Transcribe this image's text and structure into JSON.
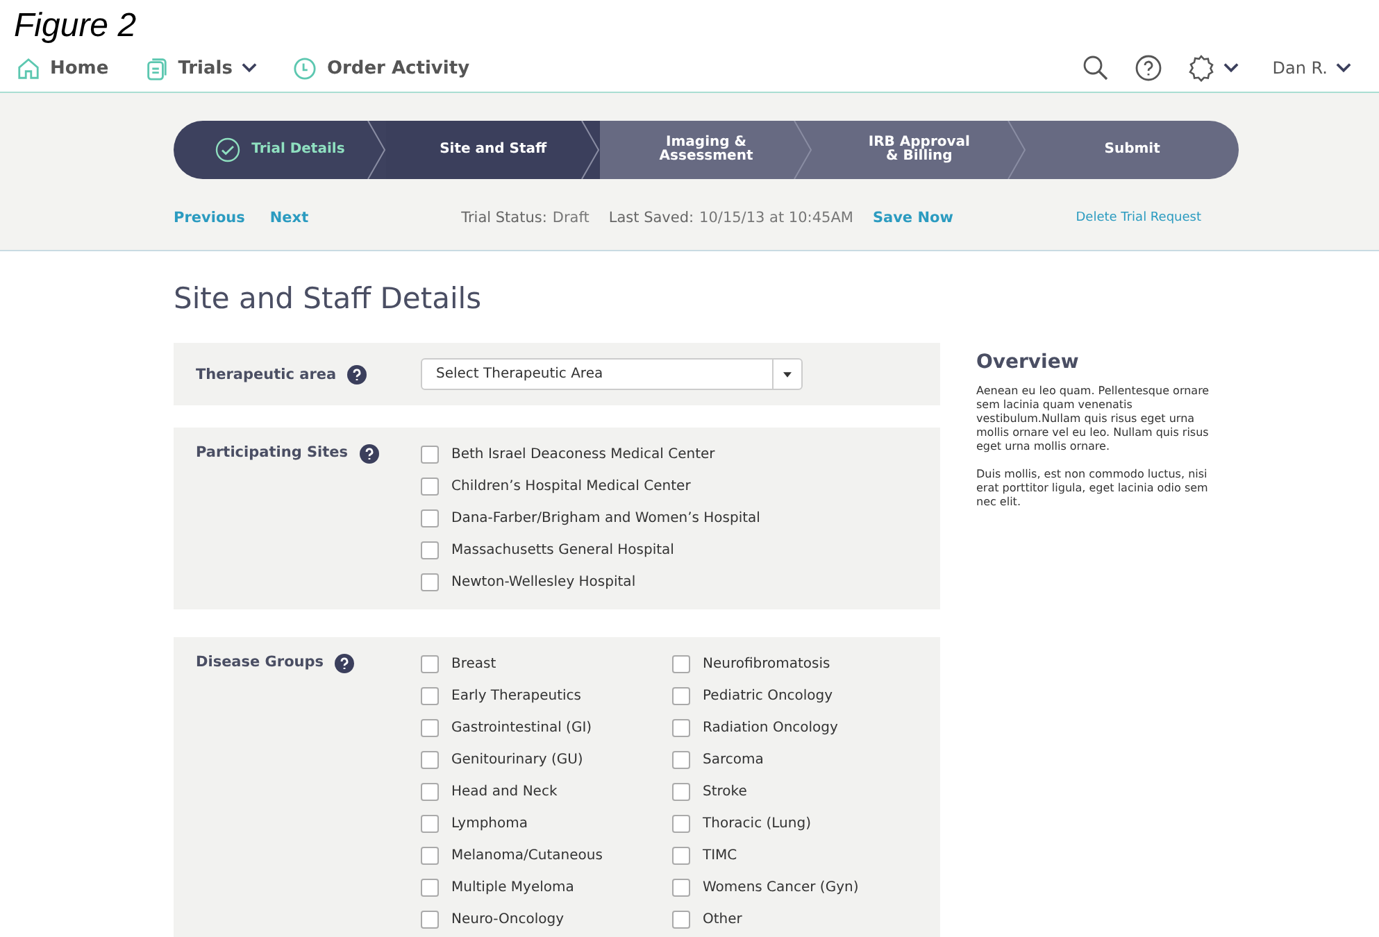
{
  "caption": "Figure 2",
  "nav": {
    "items": [
      {
        "label": "Home",
        "kind": "home",
        "dropdown": false
      },
      {
        "label": "Trials",
        "kind": "docs",
        "dropdown": true
      },
      {
        "label": "Order Activity",
        "kind": "clock",
        "dropdown": false
      }
    ],
    "user": "Dan R."
  },
  "steps": [
    {
      "label": "Trial Details",
      "completed": true,
      "selected": false
    },
    {
      "label": "Site and Staff",
      "completed": false,
      "selected": true
    },
    {
      "label": "Imaging & Assessment",
      "completed": false,
      "selected": false
    },
    {
      "label": "IRB Approval & Billing",
      "completed": false,
      "selected": false
    },
    {
      "label": "Submit",
      "completed": false,
      "selected": false
    }
  ],
  "toolbar": {
    "previous": "Previous",
    "next": "Next",
    "status_label": "Trial Status:",
    "status_value": "Draft",
    "saved_label": "Last Saved:",
    "saved_value": "10/15/13 at 10:45AM",
    "save": "Save Now",
    "delete": "Delete Trial Request"
  },
  "heading": "Site and Staff Details",
  "therapeutic_area": {
    "label": "Therapeutic area",
    "placeholder": "Select Therapeutic Area"
  },
  "sites": {
    "label": "Participating Sites",
    "options": [
      {
        "label": "Beth Israel Deaconess Medical Center",
        "checked": false
      },
      {
        "label": "Children’s Hospital Medical Center",
        "checked": false
      },
      {
        "label": "Dana-Farber/Brigham and Women’s Hospital",
        "checked": false
      },
      {
        "label": "Massachusetts General Hospital",
        "checked": false
      },
      {
        "label": "Newton-Wellesley Hospital",
        "checked": false
      }
    ]
  },
  "disease_groups": {
    "label": "Disease Groups",
    "columns": [
      [
        {
          "label": "Breast",
          "checked": false
        },
        {
          "label": "Early Therapeutics",
          "checked": false
        },
        {
          "label": "Gastrointestinal (GI)",
          "checked": false
        },
        {
          "label": "Genitourinary (GU)",
          "checked": false
        },
        {
          "label": "Head and Neck",
          "checked": false
        },
        {
          "label": "Lymphoma",
          "checked": false
        },
        {
          "label": "Melanoma/Cutaneous",
          "checked": false
        },
        {
          "label": "Multiple Myeloma",
          "checked": false
        },
        {
          "label": "Neuro-Oncology",
          "checked": false
        }
      ],
      [
        {
          "label": "Neurofibromatosis",
          "checked": false
        },
        {
          "label": "Pediatric Oncology",
          "checked": false
        },
        {
          "label": "Radiation Oncology",
          "checked": false
        },
        {
          "label": "Sarcoma",
          "checked": false
        },
        {
          "label": "Stroke",
          "checked": false
        },
        {
          "label": "Thoracic (Lung)",
          "checked": false
        },
        {
          "label": "TIMC",
          "checked": false
        },
        {
          "label": "Womens Cancer (Gyn)",
          "checked": false
        },
        {
          "label": "Other",
          "checked": false
        }
      ]
    ]
  },
  "overview": {
    "title": "Overview",
    "paragraphs": [
      "Aenean eu leo quam. Pellentesque ornare sem lacinia quam venenatis vestibulum.Nullam quis risus eget urna mollis ornare vel eu leo. Nullam quis risus eget urna mollis ornare.",
      "Duis mollis, est non commodo luctus, nisi erat porttitor ligula, eget lacinia odio sem nec elit."
    ]
  }
}
